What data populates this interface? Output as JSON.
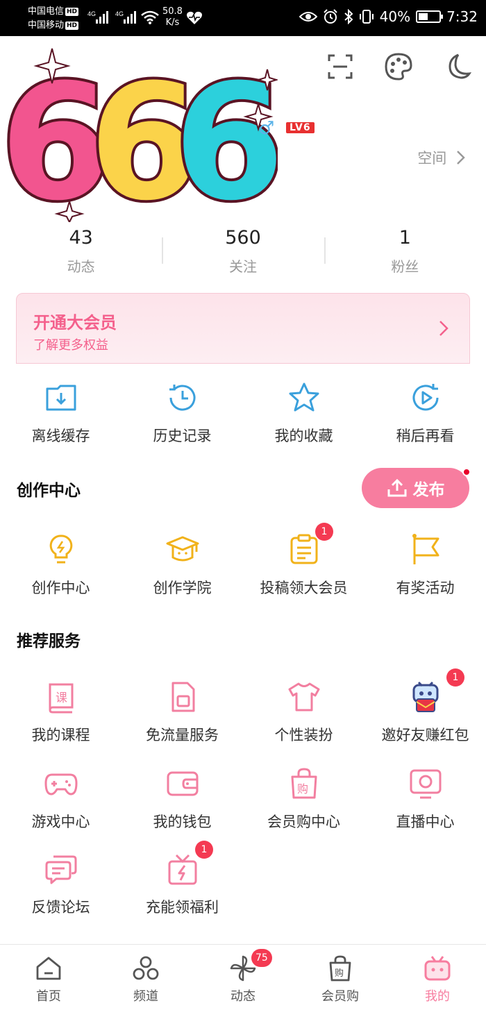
{
  "status_bar": {
    "carrier1": "中国电信",
    "carrier2": "中国移动",
    "hd": "HD",
    "net1": "4G",
    "net2": "4G",
    "speed_value": "50.8",
    "speed_unit": "K/s",
    "battery": "40%",
    "time": "7:32"
  },
  "header": {
    "sticker_text": "666",
    "level": "LV6",
    "gender_symbol": "♂",
    "space_label": "空间"
  },
  "stats": [
    {
      "value": "43",
      "label": "动态"
    },
    {
      "value": "560",
      "label": "关注"
    },
    {
      "value": "1",
      "label": "粉丝"
    }
  ],
  "vip": {
    "title": "开通大会员",
    "subtitle": "了解更多权益"
  },
  "quick": [
    {
      "label": "离线缓存",
      "icon": "download-folder-icon"
    },
    {
      "label": "历史记录",
      "icon": "history-clock-icon"
    },
    {
      "label": "我的收藏",
      "icon": "star-icon"
    },
    {
      "label": "稍后再看",
      "icon": "watch-later-icon"
    }
  ],
  "creation": {
    "title": "创作中心",
    "publish_label": "发布",
    "items": [
      {
        "label": "创作中心",
        "icon": "lightbulb-icon"
      },
      {
        "label": "创作学院",
        "icon": "graduation-cap-icon"
      },
      {
        "label": "投稿领大会员",
        "icon": "clipboard-icon",
        "badge": "1"
      },
      {
        "label": "有奖活动",
        "icon": "flag-icon"
      }
    ]
  },
  "services": {
    "title": "推荐服务",
    "items": [
      {
        "label": "我的课程",
        "icon": "course-book-icon"
      },
      {
        "label": "免流量服务",
        "icon": "sim-card-icon"
      },
      {
        "label": "个性装扮",
        "icon": "tshirt-icon"
      },
      {
        "label": "邀好友赚红包",
        "icon": "tv-mascot-redpacket-icon",
        "badge": "1"
      },
      {
        "label": "游戏中心",
        "icon": "gamepad-icon"
      },
      {
        "label": "我的钱包",
        "icon": "wallet-icon"
      },
      {
        "label": "会员购中心",
        "icon": "shopping-bag-icon"
      },
      {
        "label": "直播中心",
        "icon": "live-monitor-icon"
      },
      {
        "label": "反馈论坛",
        "icon": "chat-bubbles-icon"
      },
      {
        "label": "充能领福利",
        "icon": "gift-lightning-icon",
        "badge": "1"
      }
    ]
  },
  "tabs": [
    {
      "label": "首页",
      "icon": "home-icon"
    },
    {
      "label": "频道",
      "icon": "channels-icon"
    },
    {
      "label": "动态",
      "icon": "pinwheel-icon",
      "badge": "75"
    },
    {
      "label": "会员购",
      "icon": "shopping-bag-icon"
    },
    {
      "label": "我的",
      "icon": "tv-icon",
      "active": true
    }
  ],
  "colors": {
    "accent": "#f77d9f",
    "blue_icon": "#3aa0dc",
    "yellow_icon": "#f1b21a",
    "pink_icon": "#f27fa0",
    "badge": "#f43a52"
  }
}
